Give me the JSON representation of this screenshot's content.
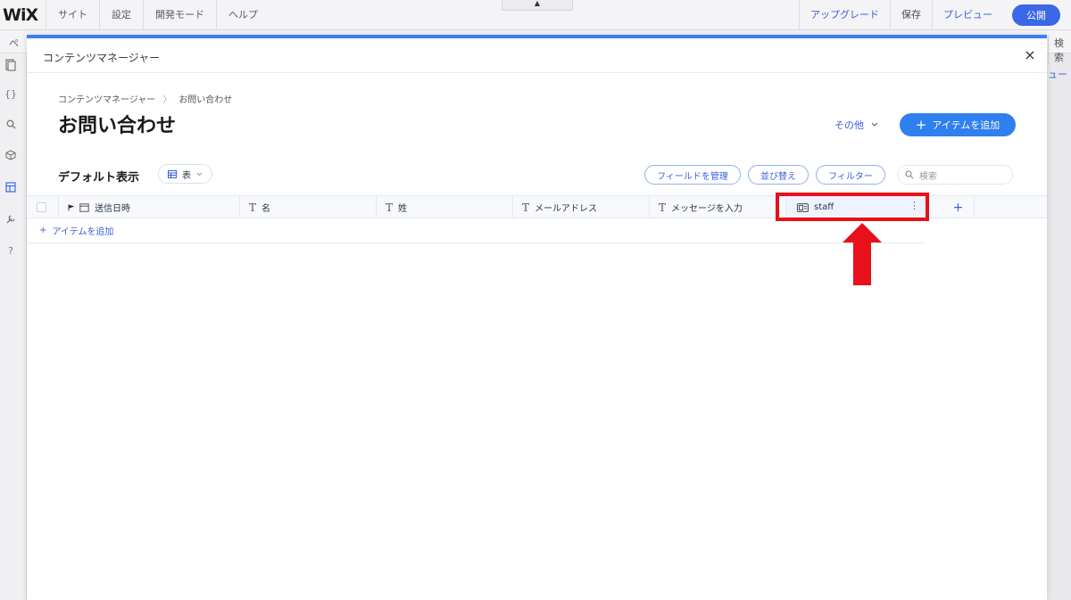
{
  "editor": {
    "logo": "WiX",
    "menu": [
      "サイト",
      "設定",
      "開発モード",
      "ヘルプ"
    ],
    "collapse_icon": "▲",
    "upgrade": "アップグレード",
    "save": "保存",
    "preview": "プレビュー",
    "publish": "公開",
    "subbar_left": "ペ",
    "subbar_right": "検索",
    "right_edge_blue": "ュー"
  },
  "modal": {
    "title": "コンテンツマネージャー",
    "close_icon": "×"
  },
  "breadcrumb": {
    "root": "コンテンツマネージャー",
    "separator": "〉",
    "current": "お問い合わせ"
  },
  "page": {
    "title": "お問い合わせ",
    "more_label": "その他",
    "add_item_label": "アイテムを追加"
  },
  "view": {
    "title": "デフォルト表示",
    "mode_label": "表",
    "manage_fields": "フィールドを管理",
    "sort": "並び替え",
    "filter": "フィルター",
    "search_placeholder": "検索"
  },
  "table": {
    "columns": [
      {
        "label": "送信日時",
        "icon": "calendar-icon"
      },
      {
        "label": "名",
        "icon": "text-type-icon"
      },
      {
        "label": "姓",
        "icon": "text-type-icon"
      },
      {
        "label": "メールアドレス",
        "icon": "text-type-icon"
      },
      {
        "label": "メッセージを入力",
        "icon": "text-type-icon"
      },
      {
        "label": "staff",
        "icon": "reference-icon"
      }
    ],
    "add_row_label": "アイテムを追加"
  },
  "annotation": {
    "highlight_color": "#e8101a"
  }
}
